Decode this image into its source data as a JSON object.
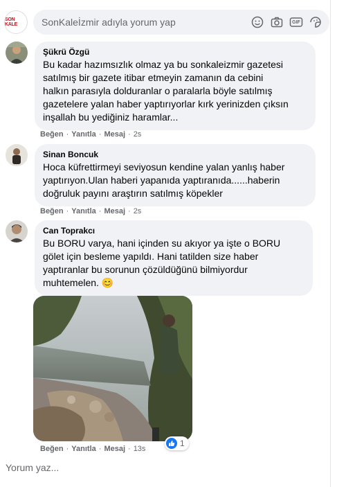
{
  "compose": {
    "page_name_logo": "SON KALE",
    "placeholder": "SonKaleİzmir adıyla yorum yap",
    "icons": [
      "smiley-icon",
      "camera-icon",
      "gif-icon",
      "sticker-icon"
    ],
    "gif_label": "GIF"
  },
  "comments": [
    {
      "author": "Şükrü Özgü",
      "text": "Bu kadar hazımsızlık olmaz ya bu sonkaleizmir gazetesi\nsatılmış bir gazete itibar etmeyin zamanın da cebini\nhalkın parasıyla dolduranlar o paralarla böyle satılmış\ngazetelere yalan haber yaptırıyorlar kırk yerinizden çıksın\ninşallah bu yediğiniz haramlar...",
      "like": "Beğen",
      "reply": "Yanıtla",
      "message": "Mesaj",
      "time": "2s"
    },
    {
      "author": "Sinan Boncuk",
      "text": "Hoca küfrettirmeyi seviyosun kendine yalan yanlış haber\nyaptırıyon.Ulan haberi yapanıda yaptıranıda......haberin\ndoğruluk payını araştırın satılmış köpekler",
      "like": "Beğen",
      "reply": "Yanıtla",
      "message": "Mesaj",
      "time": "2s"
    },
    {
      "author": "Can Toprakcı",
      "text": "Bu BORU varya, hani içinden su akıyor ya işte o BORU\ngölet için besleme yapıldı. Hani tatilden size haber\nyaptıranlar bu sorunun çözüldüğünü bilmiyordur\nmuhtemelen. 😊",
      "like": "Beğen",
      "reply": "Yanıtla",
      "message": "Mesaj",
      "time": "13s",
      "reaction_count": "1"
    }
  ],
  "separator": "·",
  "bottom": {
    "placeholder": "Yorum yaz..."
  },
  "colors": {
    "bubble": "#f0f2f5",
    "meta": "#65676b",
    "like_blue": "#1877f2",
    "logo_red": "#d0121b"
  }
}
